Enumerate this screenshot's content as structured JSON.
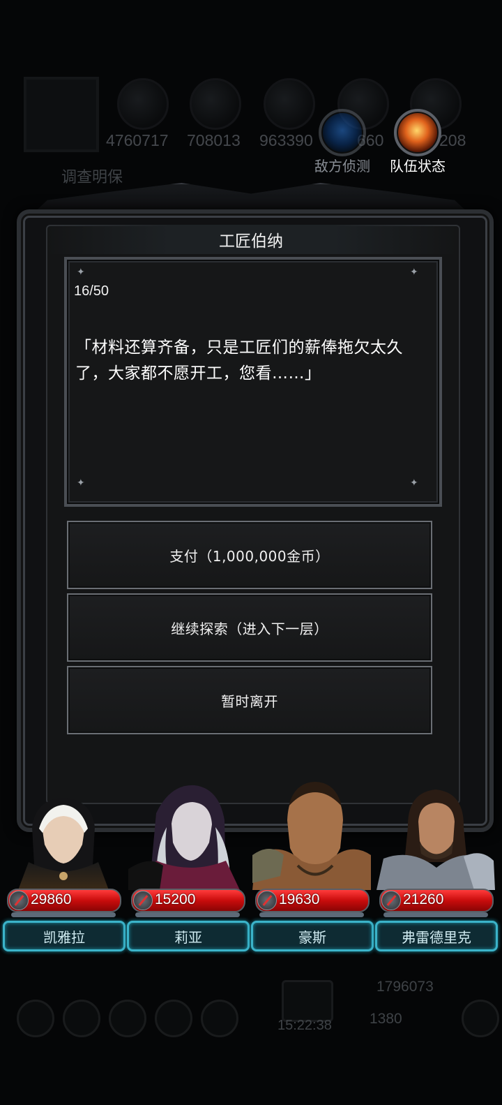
{
  "background": {
    "resources": [
      "4760717",
      "708013",
      "963390",
      "660",
      "208"
    ],
    "status_text": "调查明保",
    "gold": "1796073",
    "gems": "1380",
    "clock": "15:22:38"
  },
  "top_buttons": [
    {
      "label": "敌方侦测",
      "icon": "radar-icon"
    },
    {
      "label": "队伍状态",
      "icon": "flame-emblem-icon"
    }
  ],
  "dialog": {
    "title": "工匠伯纳",
    "progress": "16/50",
    "text": "「材料还算齐备，只是工匠们的薪俸拖欠太久了，大家都不愿开工，您看……」"
  },
  "choices": [
    {
      "label": "支付（1,000,000金币）"
    },
    {
      "label": "继续探索（进入下一层）"
    },
    {
      "label": "暂时离开"
    }
  ],
  "heroes": [
    {
      "name": "凯雅拉",
      "hp": "29860",
      "accent": "#c8a46a"
    },
    {
      "name": "莉亚",
      "hp": "15200",
      "accent": "#b03a7a"
    },
    {
      "name": "豪斯",
      "hp": "19630",
      "accent": "#9a6a3a"
    },
    {
      "name": "弗雷德里克",
      "hp": "21260",
      "accent": "#8a8f96"
    }
  ],
  "colors": {
    "hp_red": "#c90c0c",
    "name_plate_border": "#3bb3c9",
    "panel_bg": "#141516"
  }
}
